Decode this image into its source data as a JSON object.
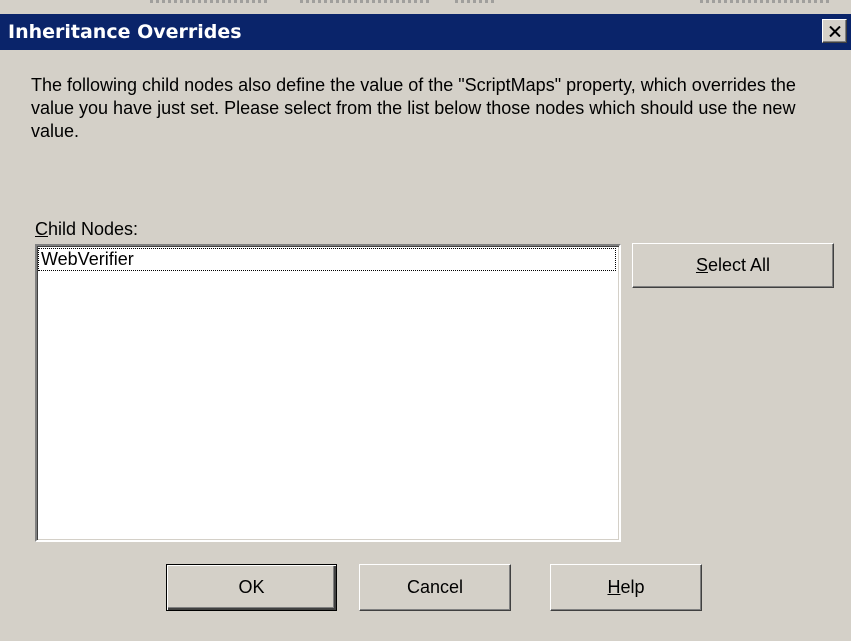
{
  "dialog": {
    "title": "Inheritance Overrides",
    "close_icon": "close-icon",
    "message": "The following child nodes also define the value of the  \"ScriptMaps\" property, which overrides the value you have just set.  Please select from the list below those nodes which should use the new value.",
    "child_nodes_label": {
      "mnemonic": "C",
      "rest": "hild Nodes:"
    },
    "child_nodes": [
      {
        "label": "WebVerifier",
        "focused": true
      }
    ],
    "buttons": {
      "select_all": {
        "mnemonic": "S",
        "rest": "elect All"
      },
      "ok": "OK",
      "cancel": "Cancel",
      "help": {
        "mnemonic": "H",
        "rest": "elp"
      }
    }
  },
  "colors": {
    "titlebar": "#0a246a",
    "face": "#d4d0c8",
    "window": "#ffffff"
  }
}
